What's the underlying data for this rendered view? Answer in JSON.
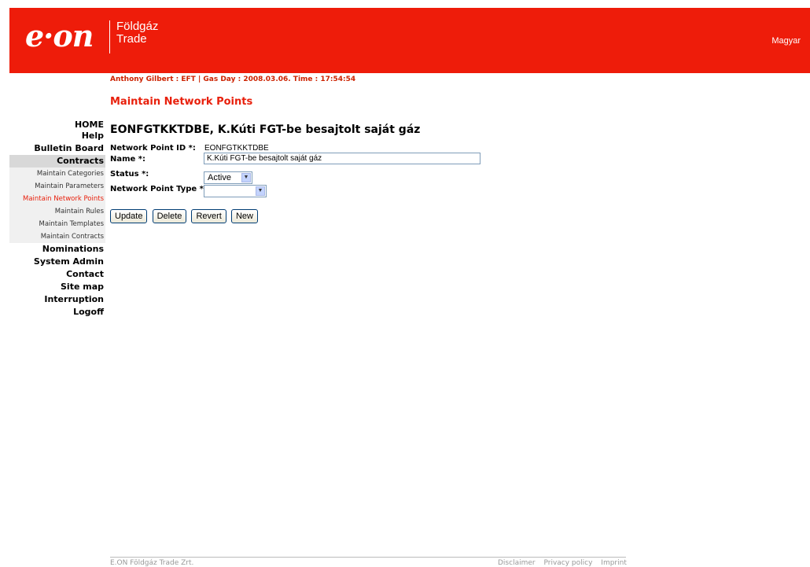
{
  "header": {
    "logo_text": "e·on",
    "sub_line1": "Földgáz",
    "sub_line2": "Trade",
    "language_link": "Magyar"
  },
  "session": "Anthony Gilbert : EFT | Gas Day : 2008.03.06. Time : 17:54:54",
  "page_title": "Maintain Network Points",
  "nav": {
    "home": "HOME",
    "help": "Help",
    "bulletin": "Bulletin Board",
    "contracts": "Contracts",
    "sub": [
      "Maintain Categories",
      "Maintain Parameters",
      "Maintain Network Points",
      "Maintain Rules",
      "Maintain Templates",
      "Maintain Contracts"
    ],
    "nominations": "Nominations",
    "system_admin": "System Admin",
    "contact": "Contact",
    "site_map": "Site map",
    "interruption": "Interruption",
    "logoff": "Logoff"
  },
  "record_title": "EONFGTKKTDBE, K.Kúti FGT-be besajtolt saját gáz",
  "form": {
    "id_label": "Network Point ID *:",
    "id_value": "EONFGTKKTDBE",
    "name_label": "Name *:",
    "name_value": "K.Kúti FGT-be besajtolt saját gáz",
    "status_label": "Status *:",
    "status_value": "Active",
    "type_label": "Network Point Type *:",
    "type_value": ""
  },
  "buttons": {
    "update": "Update",
    "delete": "Delete",
    "revert": "Revert",
    "new": "New"
  },
  "footer": {
    "company": "E.ON Földgáz Trade Zrt.",
    "disclaimer": "Disclaimer",
    "privacy": "Privacy policy",
    "imprint": "Imprint"
  },
  "colors": {
    "brand_red": "#ee1c0a",
    "accent_text": "#e8200c"
  }
}
